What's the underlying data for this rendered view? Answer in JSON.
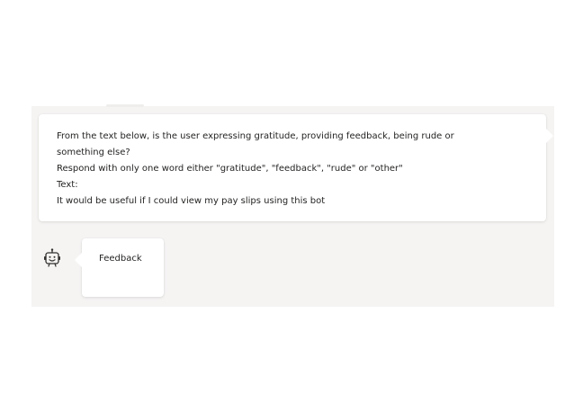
{
  "conversation": {
    "user_message": {
      "lines": [
        "From the text below, is the user expressing gratitude, providing feedback, being rude or",
        "something else?",
        "Respond with only one word either \"gratitude\", \"feedback\", \"rude\" or \"other\"",
        "Text:",
        "It would be useful if I could view my pay slips using this bot"
      ]
    },
    "bot_message": {
      "avatar_icon": "bot-icon",
      "text": "Feedback"
    }
  },
  "colors": {
    "panel_background": "#f5f4f3",
    "bubble_background": "#ffffff",
    "text": "#252423"
  }
}
